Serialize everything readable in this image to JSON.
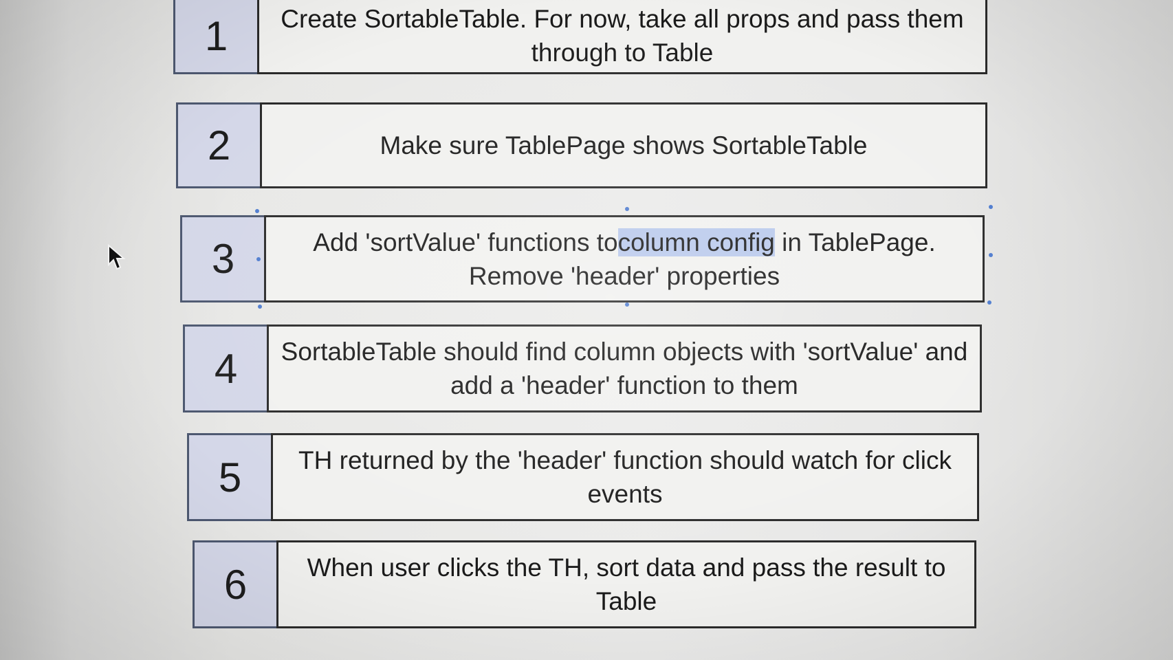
{
  "steps": [
    {
      "number": "1",
      "text_before": "Create SortableTable.  For now, take all props and pass them through to Table",
      "highlight": "",
      "text_after": ""
    },
    {
      "number": "2",
      "text_before": "Make sure TablePage shows SortableTable",
      "highlight": "",
      "text_after": ""
    },
    {
      "number": "3",
      "text_before": "Add 'sortValue' functions to",
      "highlight": "column config",
      "text_after": " in TablePage. Remove 'header' properties"
    },
    {
      "number": "4",
      "text_before": "SortableTable should find column objects with 'sortValue' and add a 'header' function to them",
      "highlight": "",
      "text_after": ""
    },
    {
      "number": "5",
      "text_before": "TH returned by the 'header' function should watch for click events",
      "highlight": "",
      "text_after": ""
    },
    {
      "number": "6",
      "text_before": "When user clicks the TH, sort data and pass the result to Table",
      "highlight": "",
      "text_after": ""
    }
  ],
  "colors": {
    "number_box_fill": "#d4d7e8",
    "number_box_border": "#4d5870",
    "text_box_border": "#2a2a2a",
    "selection_highlight": "#b9c9ec",
    "selection_handle": "#4f7ccf"
  },
  "icons": {
    "cursor": "mouse-pointer-icon"
  }
}
